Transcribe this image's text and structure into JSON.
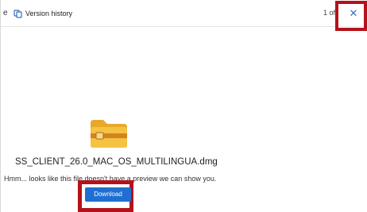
{
  "toolbar": {
    "left_partial": "e",
    "version_history_label": "Version history",
    "page_indicator": "1 of",
    "close_glyph": "✕"
  },
  "file": {
    "name": "SS_CLIENT_26.0_MAC_OS_MULTILINGUA.dmg",
    "preview_message": "Hmm... looks like this file doesn't have a preview we can show you.",
    "download_label": "Download",
    "icon": "folder-icon"
  },
  "colors": {
    "accent": "#1f6fd1",
    "highlight": "#b3121a",
    "folder": "#f5c242"
  },
  "icons": {
    "version_history": "version-history-icon",
    "close": "close-icon"
  }
}
